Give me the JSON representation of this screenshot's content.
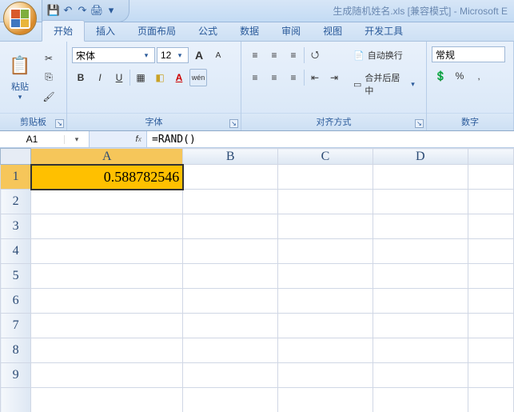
{
  "title": "生成随机姓名.xls  [兼容模式] - Microsoft E",
  "qat": {
    "save": "💾",
    "undo": "↶",
    "redo": "↷",
    "print": "🖨",
    "more": "▾"
  },
  "tabs": [
    "开始",
    "插入",
    "页面布局",
    "公式",
    "数据",
    "审阅",
    "视图",
    "开发工具"
  ],
  "ribbon": {
    "clipboard": {
      "title": "剪贴板",
      "paste": "粘贴",
      "cut": "✂",
      "copy": "⎘",
      "fmt": "🖌"
    },
    "font": {
      "title": "字体",
      "name": "宋体",
      "size": "12",
      "growA": "A",
      "shrinkA": "A",
      "bold": "B",
      "italic": "I",
      "underline": "U",
      "border": "▦",
      "fill": "◧",
      "color": "A",
      "phonetic": "wén"
    },
    "align": {
      "title": "对齐方式",
      "top": "≡",
      "mid": "≡",
      "bot": "≡",
      "left": "≡",
      "center": "≡",
      "right": "≡",
      "dind": "⇤",
      "iind": "⇥",
      "orient": "⭯",
      "wrap": "自动换行",
      "merge": "合并后居中"
    },
    "number": {
      "title": "数字",
      "fmt": "常规",
      "cur": "💲",
      "pct": "%",
      "comma": ",",
      "inc": "←",
      "dec": "→"
    }
  },
  "namebox": "A1",
  "formula": "=RAND()",
  "columns": [
    "A",
    "B",
    "C",
    "D",
    ""
  ],
  "rows": [
    "1",
    "2",
    "3",
    "4",
    "5",
    "6",
    "7",
    "8",
    "9",
    ""
  ],
  "activeCell": {
    "row": 0,
    "col": 0,
    "value": "0.588782546"
  },
  "chart_data": null
}
